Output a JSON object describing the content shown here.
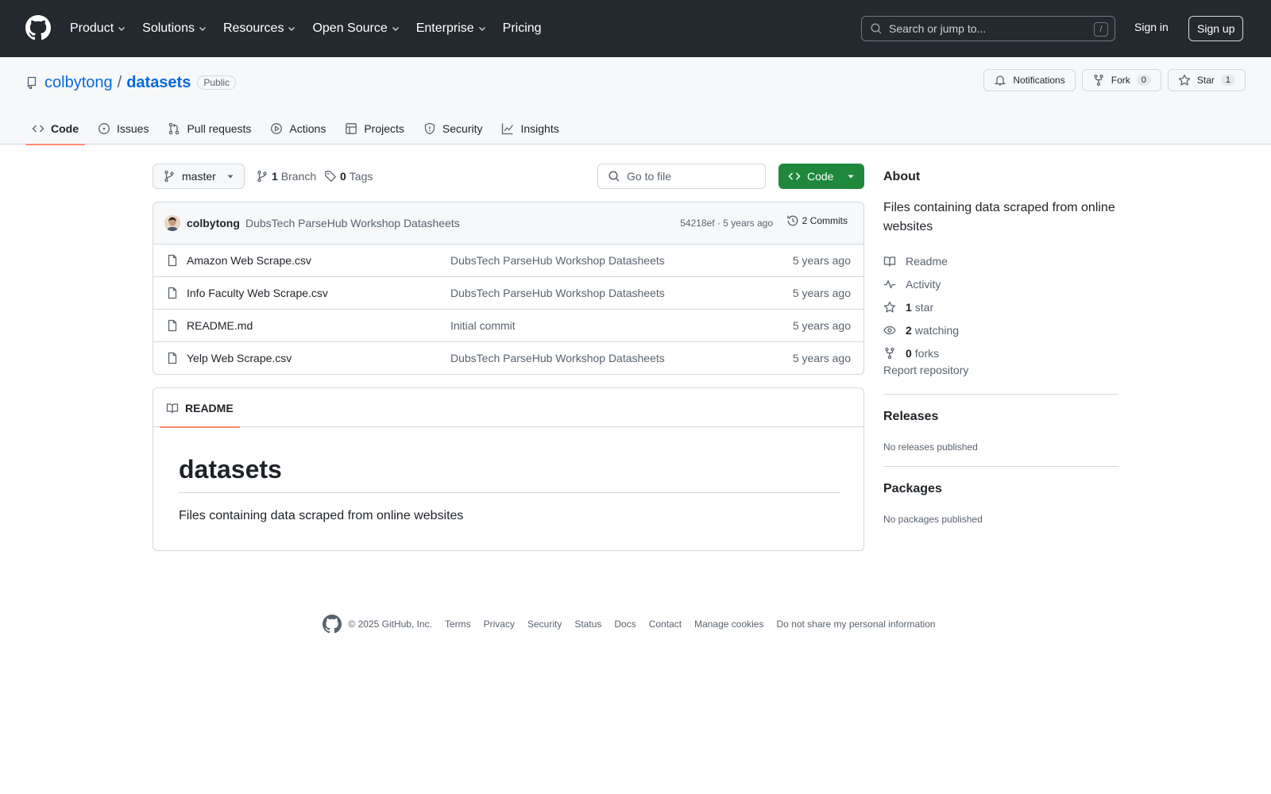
{
  "header": {
    "nav": [
      "Product",
      "Solutions",
      "Resources",
      "Open Source",
      "Enterprise",
      "Pricing"
    ],
    "search_placeholder": "Search or jump to...",
    "search_shortcut": "/",
    "sign_in": "Sign in",
    "sign_up": "Sign up"
  },
  "repo": {
    "owner": "colbytong",
    "separator": "/",
    "name": "datasets",
    "visibility": "Public",
    "notifications_label": "Notifications",
    "fork_label": "Fork",
    "fork_count": "0",
    "star_label": "Star",
    "star_count": "1",
    "tabs": [
      "Code",
      "Issues",
      "Pull requests",
      "Actions",
      "Projects",
      "Security",
      "Insights"
    ]
  },
  "toolbar": {
    "branch": "master",
    "branch_count": "1",
    "branch_label": "Branch",
    "tag_count": "0",
    "tag_label": "Tags",
    "goto_placeholder": "Go to file",
    "code_label": "Code"
  },
  "commit": {
    "author": "colbytong",
    "message": "DubsTech ParseHub Workshop Datasheets",
    "meta": "54218ef · 5 years ago",
    "count": "2 Commits"
  },
  "files": [
    {
      "name": "Amazon Web Scrape.csv",
      "message": "DubsTech ParseHub Workshop Datasheets",
      "time": "5 years ago"
    },
    {
      "name": "Info Faculty Web Scrape.csv",
      "message": "DubsTech ParseHub Workshop Datasheets",
      "time": "5 years ago"
    },
    {
      "name": "README.md",
      "message": "Initial commit",
      "time": "5 years ago"
    },
    {
      "name": "Yelp Web Scrape.csv",
      "message": "DubsTech ParseHub Workshop Datasheets",
      "time": "5 years ago"
    }
  ],
  "readme": {
    "tab": "README",
    "heading": "datasets",
    "body": "Files containing data scraped from online websites"
  },
  "sidebar": {
    "about_title": "About",
    "description": "Files containing data scraped from online websites",
    "readme": "Readme",
    "activity": "Activity",
    "stars_count": "1",
    "stars_label": "star",
    "watching_count": "2",
    "watching_label": "watching",
    "forks_count": "0",
    "forks_label": "forks",
    "report": "Report repository",
    "releases_title": "Releases",
    "releases_none": "No releases published",
    "packages_title": "Packages",
    "packages_none": "No packages published"
  },
  "footer": {
    "copyright": "© 2025 GitHub, Inc.",
    "links": [
      "Terms",
      "Privacy",
      "Security",
      "Status",
      "Docs",
      "Contact",
      "Manage cookies",
      "Do not share my personal information"
    ]
  },
  "colors": {
    "header_bg": "#24292f",
    "link": "#0969da",
    "primary_button": "#1f883d",
    "tab_underline": "#fd8c73"
  }
}
